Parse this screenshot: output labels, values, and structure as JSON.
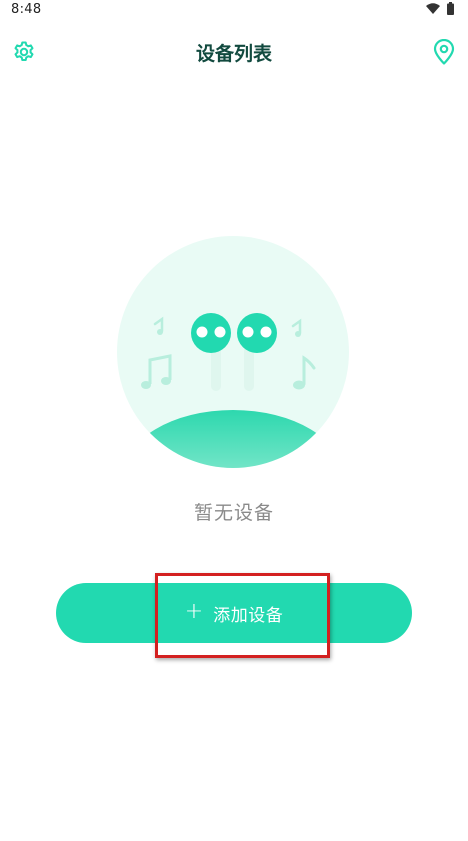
{
  "status_bar": {
    "time": "8:48",
    "icons": [
      "wifi-icon",
      "battery-icon"
    ]
  },
  "header": {
    "title": "设备列表",
    "left_icon": "gear-icon",
    "right_icon": "location-pin-icon"
  },
  "empty_state": {
    "illustration": "earbuds-with-music-notes",
    "message": "暂无设备"
  },
  "add_button": {
    "icon": "plus-icon",
    "icon_glyph": "+",
    "label": "添加设备"
  },
  "colors": {
    "accent": "#22d9b0",
    "title": "#124a3f",
    "illustration_bg": "#e9fbf5",
    "highlight": "#d32020"
  }
}
